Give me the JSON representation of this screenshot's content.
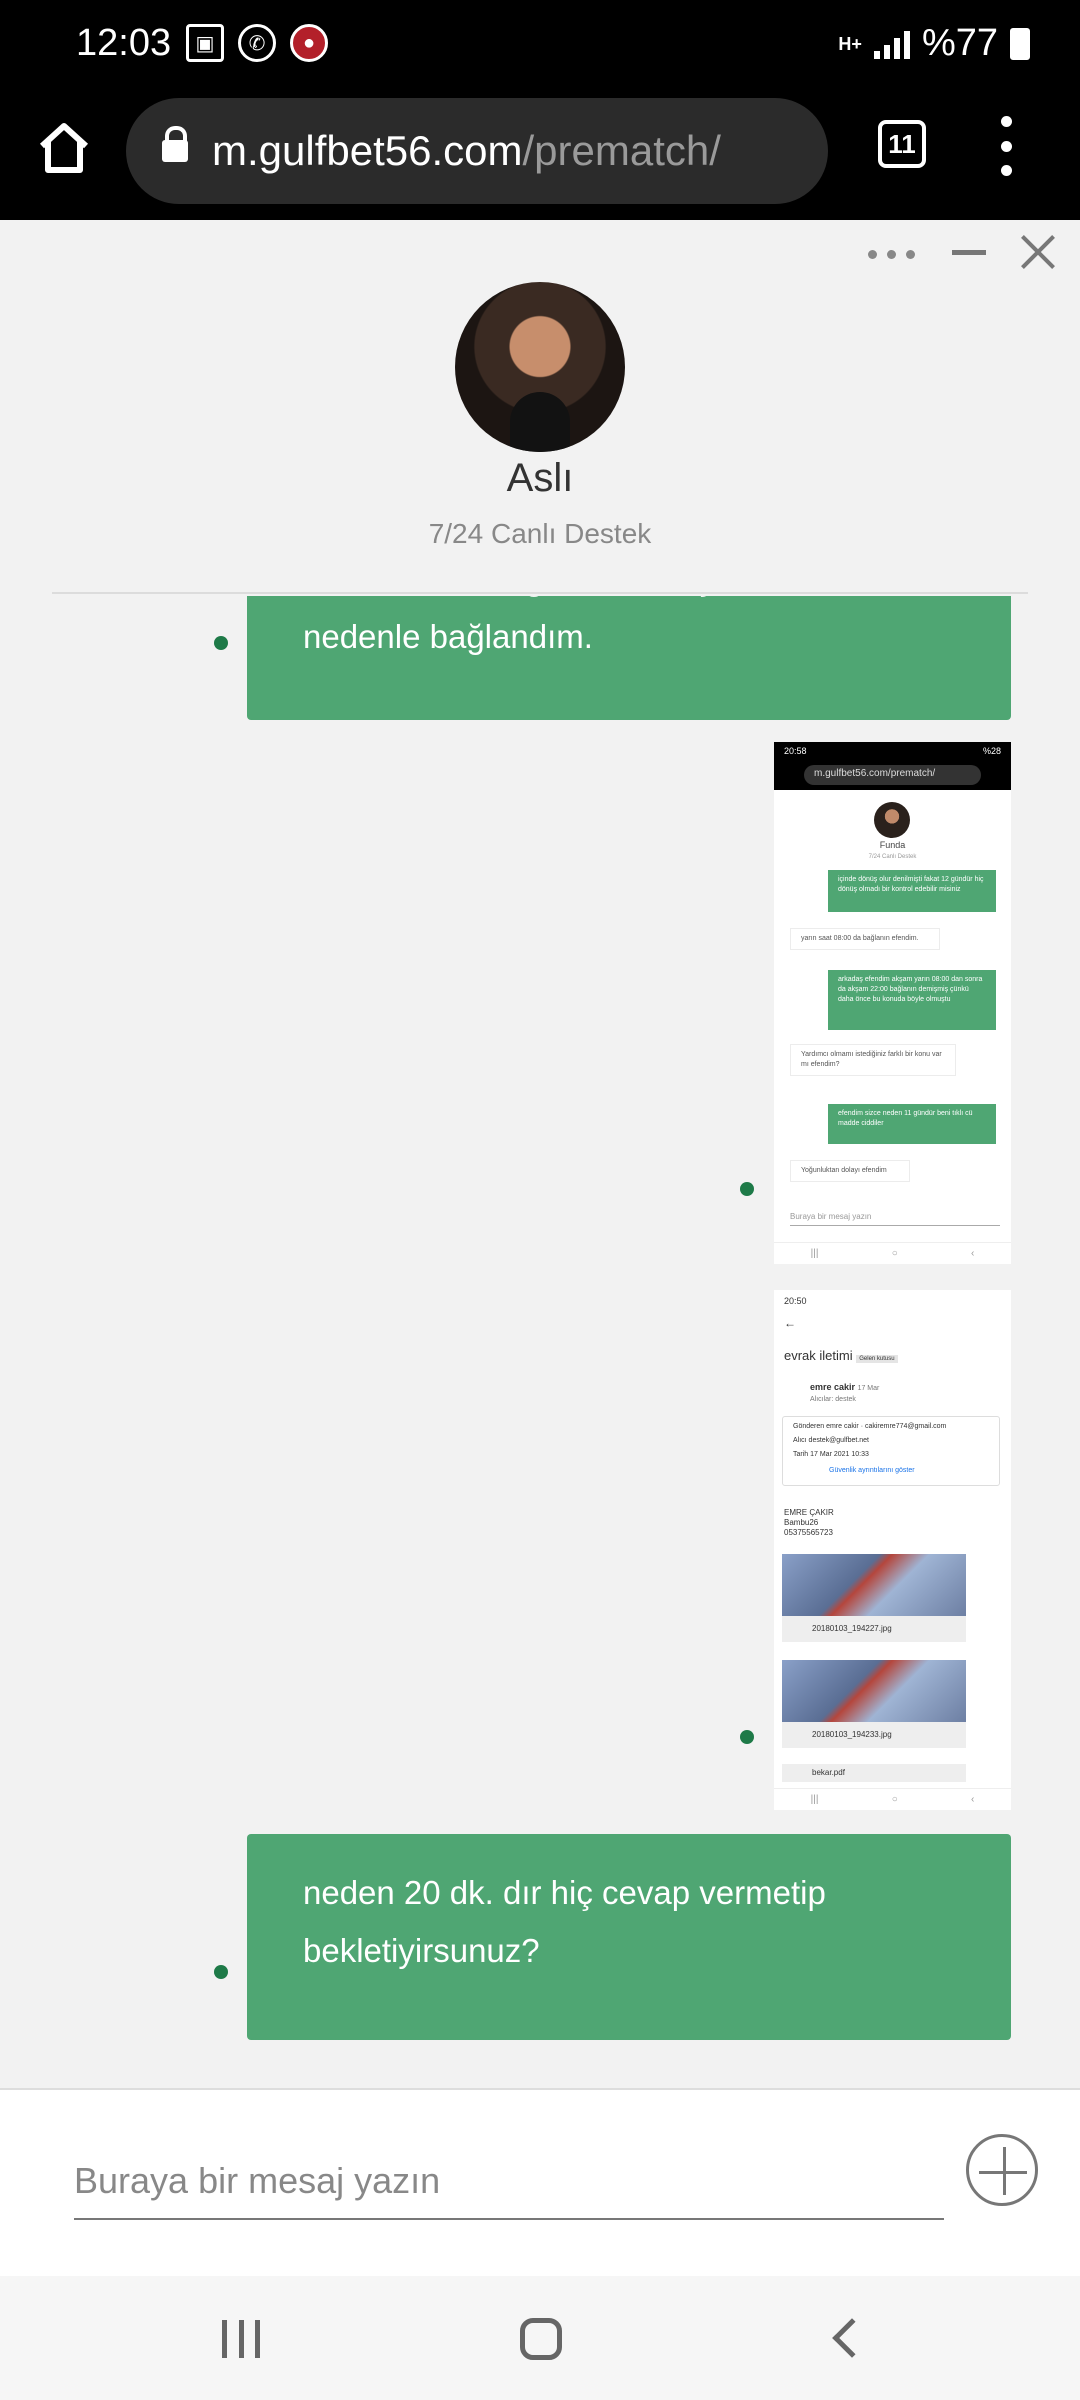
{
  "status_bar": {
    "time": "12:03",
    "network": "H+",
    "battery_percent": "%77",
    "icons": [
      "image-icon",
      "whatsapp-icon",
      "call-recording-icon"
    ]
  },
  "browser": {
    "domain": "m.gulfbet56.com",
    "path": "/prematch/",
    "tab_count": "11"
  },
  "chat": {
    "agent_name": "Aslı",
    "agent_role": "7/24 Canlı Destek",
    "messages": {
      "m1_cut_line": "sonra tekrar bağlanın demişti bu",
      "m1_text": "nedenle bağlandım.",
      "m3_line1": "neden 20 dk. dır hiç cevap vermetip",
      "m3_line2": "bekletiyirsunuz?"
    },
    "input_placeholder": "Buraya bir mesaj yazın"
  },
  "thumb1": {
    "status_time": "20:58",
    "status_right": "%28",
    "url": "m.gulfbet56.com/prematch/",
    "agent_name": "Funda",
    "agent_role": "7/24 Canlı Destek",
    "msg_a": "içinde dönüş olur denilmişti fakat 12 gündür hiç dönüş olmadı bir kontrol edebilir misiniz",
    "msg_b": "yarın saat 08:00 da bağlanın efendim.",
    "msg_c": "arkadaş efendim akşam yarın 08:00 dan sonra da akşam 22:00 bağlanın demişmiş çünkü daha önce bu konuda böyle olmuştu",
    "msg_d": "Yardımcı olmamı istediğiniz farklı bir konu var mı efendim?",
    "msg_e": "efendim sizce neden 11 gündür beni tıklı cü madde ciddiler",
    "msg_f": "Yoğunluktan dolayı efendim",
    "input": "Buraya bir mesaj yazın"
  },
  "thumb2": {
    "status_time": "20:50",
    "subject": "evrak iletimi",
    "label": "Gelen kutusu",
    "sender": "emre cakir",
    "date": "17 Mar",
    "to_line": "Alıcılar: destek",
    "from_row": "Gönderen  emre cakir · cakiremre774@gmail.com",
    "to_row": "Alıcı  destek@gulfbet.net",
    "date_row": "Tarih  17 Mar 2021 10:33",
    "security": "Güvenlik ayrıntılarını göster",
    "body_name": "EMRE ÇAKIR",
    "body_user": "Bambu26",
    "body_phone": "05375565723",
    "file1": "20180103_194227.jpg",
    "file2": "20180103_194233.jpg",
    "file3": "bekar.pdf"
  }
}
